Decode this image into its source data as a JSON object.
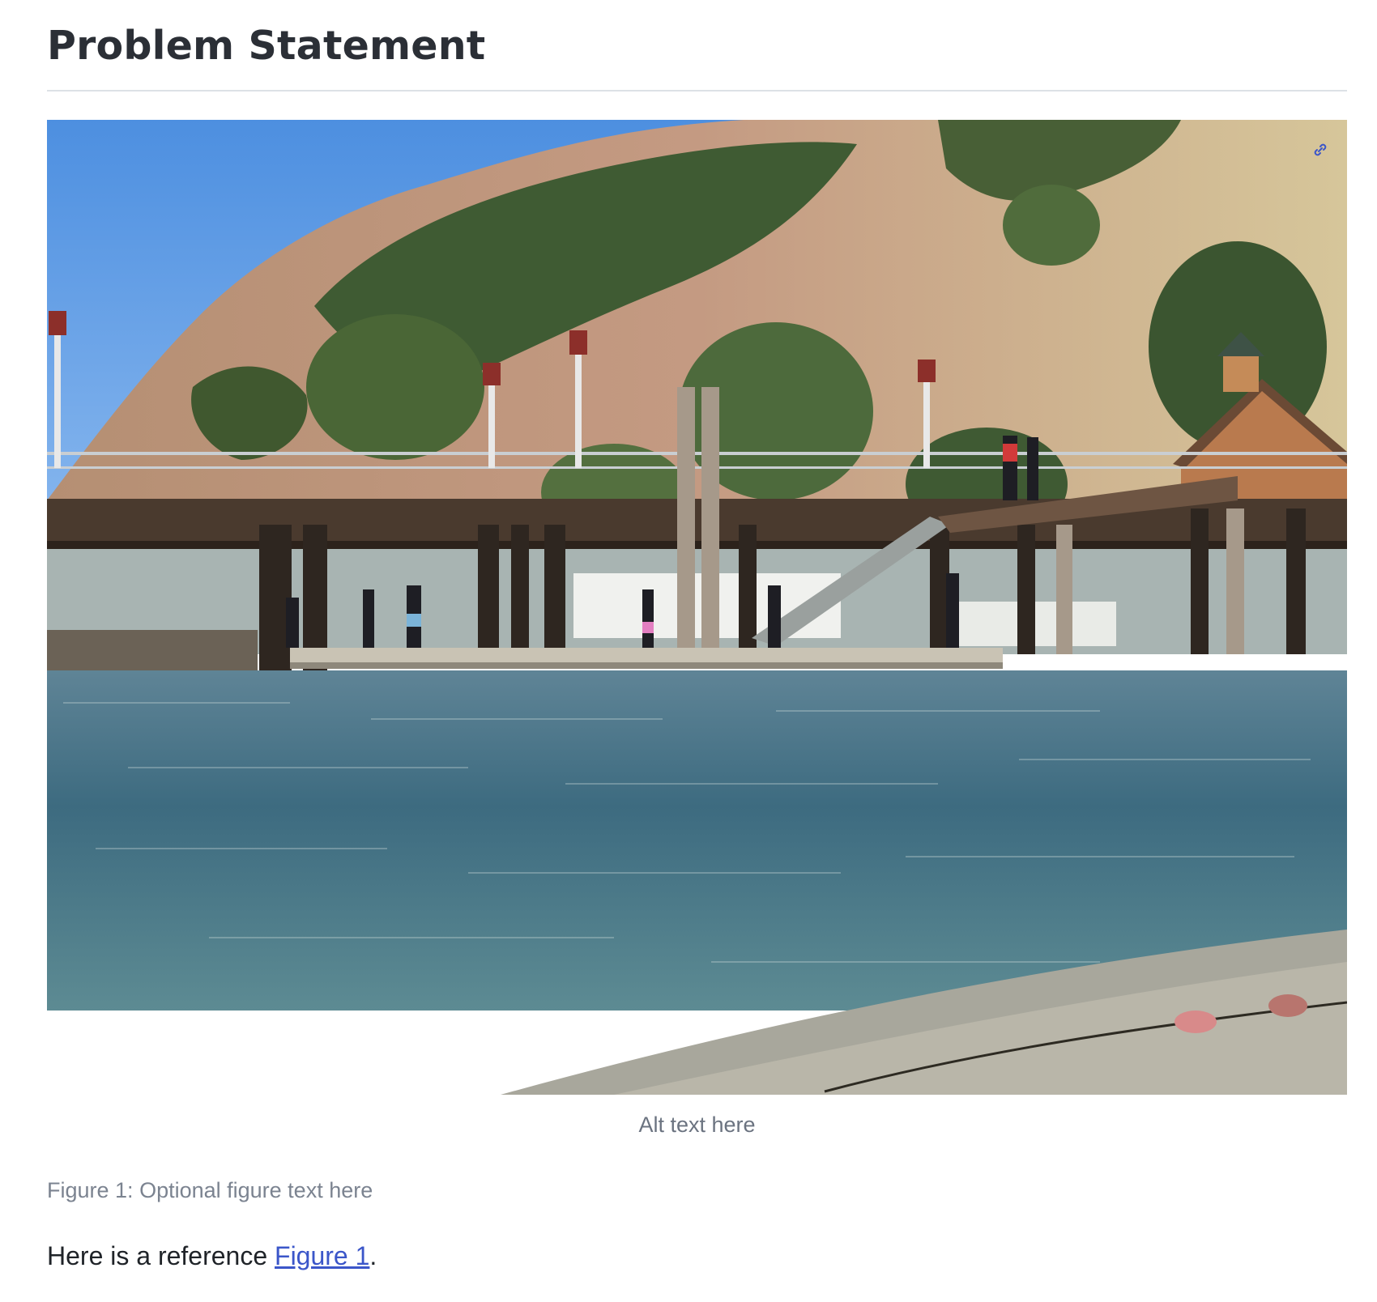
{
  "heading": {
    "title": "Problem Statement"
  },
  "figure": {
    "alt_text": "Alt text here",
    "caption_label": "Figure 1:",
    "caption_text": "Optional figure text here",
    "link_icon": "link-icon"
  },
  "paragraph": {
    "prefix": "Here is a reference ",
    "link_text": "Figure 1",
    "suffix": "."
  },
  "colors": {
    "link": "#3b56c9",
    "caption": "#6b7380",
    "rule": "#dde1e6"
  }
}
